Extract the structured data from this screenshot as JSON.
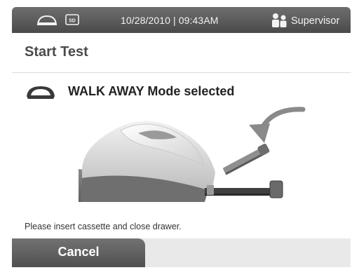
{
  "status_bar": {
    "datetime": "10/28/2010 | 09:43AM",
    "user": "Supervisor",
    "icons": [
      "drive-icon",
      "sd-card-icon",
      "user-icon"
    ],
    "sd_label": "SD"
  },
  "page": {
    "title": "Start Test"
  },
  "content": {
    "mode_text": "WALK AWAY Mode selected",
    "mode_icon": "drive-icon",
    "instruction": "Please insert cassette and close drawer."
  },
  "footer": {
    "cancel_label": "Cancel"
  },
  "colors": {
    "bar_dark": "#4a4a4a",
    "bar_light": "#6e6e6e",
    "text_light": "#f2f2f2",
    "title_text": "#4b4b4b"
  }
}
